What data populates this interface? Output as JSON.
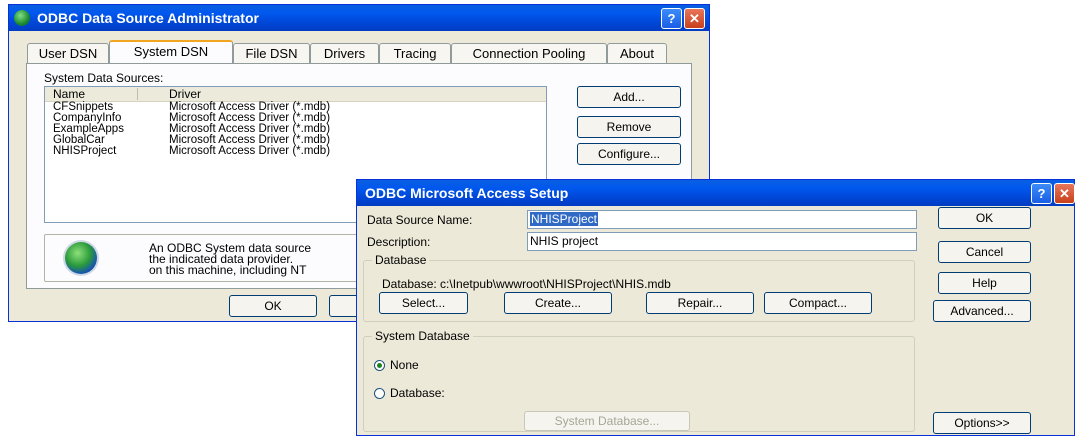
{
  "odbc_admin": {
    "title": "ODBC Data Source Administrator",
    "tabs": [
      {
        "label": "User DSN"
      },
      {
        "label": "System DSN"
      },
      {
        "label": "File DSN"
      },
      {
        "label": "Drivers"
      },
      {
        "label": "Tracing"
      },
      {
        "label": "Connection Pooling"
      },
      {
        "label": "About"
      }
    ],
    "list_label": "System Data Sources:",
    "columns": [
      "Name",
      "Driver"
    ],
    "rows": [
      {
        "name": "CFSnippets",
        "driver": "Microsoft Access Driver (*.mdb)"
      },
      {
        "name": "CompanyInfo",
        "driver": "Microsoft Access Driver (*.mdb)"
      },
      {
        "name": "ExampleApps",
        "driver": "Microsoft Access Driver (*.mdb)"
      },
      {
        "name": "GlobalCar",
        "driver": "Microsoft Access Driver (*.mdb)"
      },
      {
        "name": "NHISProject",
        "driver": "Microsoft Access Driver (*.mdb)"
      }
    ],
    "buttons": {
      "add": "Add...",
      "remove": "Remove",
      "configure": "Configure...",
      "ok": "OK"
    },
    "info_lines": [
      "An ODBC System data source",
      "the indicated data provider.",
      "on this machine, including NT"
    ]
  },
  "access_setup": {
    "title": "ODBC Microsoft Access Setup",
    "dsn_label": "Data Source Name:",
    "dsn_value": "NHISProject",
    "desc_label": "Description:",
    "desc_value": "NHIS project",
    "database_group": "Database",
    "database_path": "Database:  c:\\Inetpub\\wwwroot\\NHISProject\\NHIS.mdb",
    "db_buttons": {
      "select": "Select...",
      "create": "Create...",
      "repair": "Repair...",
      "compact": "Compact..."
    },
    "sysdb_group": "System Database",
    "radio_none": "None",
    "radio_database": "Database:",
    "sysdb_button": "System Database...",
    "side_buttons": {
      "ok": "OK",
      "cancel": "Cancel",
      "help": "Help",
      "advanced": "Advanced...",
      "options": "Options>>"
    }
  }
}
